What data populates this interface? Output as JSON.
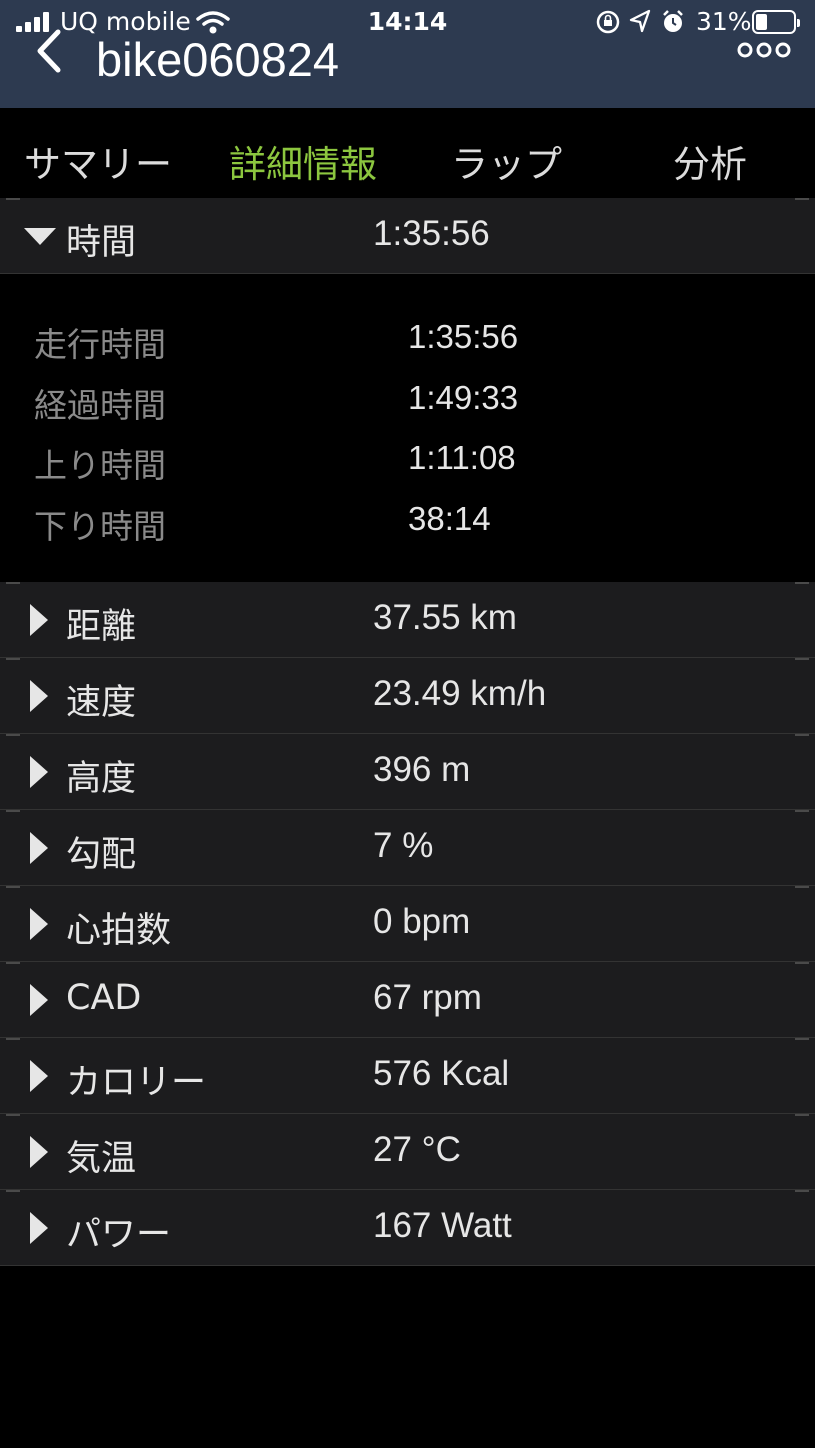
{
  "status_bar": {
    "carrier": "UQ mobile",
    "time": "14:14",
    "battery_percent": "31%",
    "battery_level": 0.31,
    "icons": [
      "signal-icon",
      "wifi-icon",
      "orientation-lock-icon",
      "location-icon",
      "alarm-icon",
      "battery-icon"
    ]
  },
  "header": {
    "title": "bike060824",
    "back_icon": "chevron-left-icon",
    "more_icon": "more-dots-icon",
    "background": "#2d3a50"
  },
  "tabs": [
    {
      "label": "サマリー",
      "active": false
    },
    {
      "label": "詳細情報",
      "active": true
    },
    {
      "label": "ラップ",
      "active": false
    },
    {
      "label": "分析",
      "active": false
    }
  ],
  "accent_color": "#8cc63f",
  "time_section": {
    "label": "時間",
    "value": "1:35:56",
    "expanded": true,
    "items": [
      {
        "label": "走行時間",
        "value": "1:35:56"
      },
      {
        "label": "経過時間",
        "value": "1:49:33"
      },
      {
        "label": "上り時間",
        "value": "1:11:08"
      },
      {
        "label": "下り時間",
        "value": "38:14"
      }
    ]
  },
  "rows": [
    {
      "label": "距離",
      "value": "37.55 km"
    },
    {
      "label": "速度",
      "value": "23.49 km/h"
    },
    {
      "label": "高度",
      "value": "396 m"
    },
    {
      "label": "勾配",
      "value": "7 %"
    },
    {
      "label": "心拍数",
      "value": "0 bpm"
    },
    {
      "label": "CAD",
      "value": "67 rpm"
    },
    {
      "label": "カロリー",
      "value": "576 Kcal"
    },
    {
      "label": "気温",
      "value": "27 °C"
    },
    {
      "label": "パワー",
      "value": "167 Watt"
    }
  ]
}
